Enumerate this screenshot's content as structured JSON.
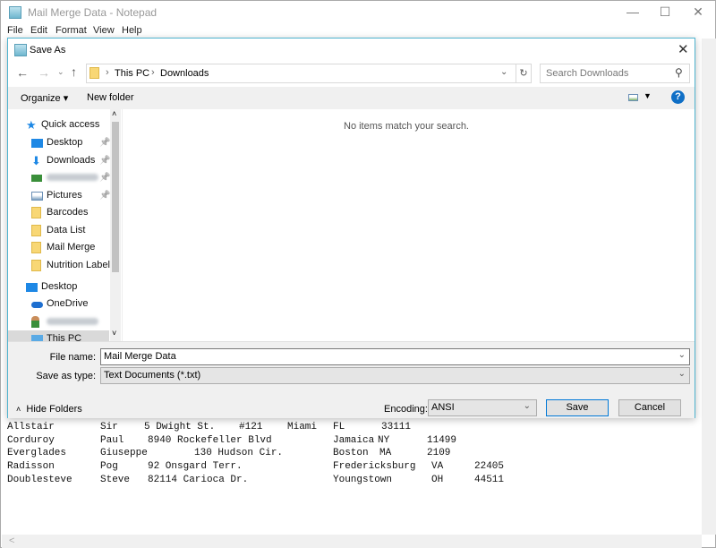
{
  "notepad": {
    "title": "Mail Merge Data - Notepad",
    "menu": [
      "File",
      "Edit",
      "Format",
      "View",
      "Help"
    ],
    "rows": [
      [
        "Allstair",
        "Sir",
        "5 Dwight St.",
        "#121",
        "Miami",
        "FL",
        "33111"
      ],
      [
        "Corduroy",
        "Paul",
        "8940 Rockefeller Blvd",
        "Jamaica",
        "NY",
        "11499"
      ],
      [
        "Everglades",
        "Giuseppe",
        "130 Hudson Cir.",
        "Boston",
        "MA",
        "2109"
      ],
      [
        "Radisson",
        "Pog",
        "92 Onsgard Terr.",
        "Fredericksburg",
        "VA",
        "22405"
      ],
      [
        "Doublesteve",
        "Steve",
        "82114 Carioca Dr.",
        "Youngstown",
        "OH",
        "44511"
      ]
    ],
    "scroll_left": "<"
  },
  "dialog": {
    "title": "Save As",
    "breadcrumb": [
      "This PC",
      "Downloads"
    ],
    "search_placeholder": "Search Downloads",
    "toolbar": {
      "organize": "Organize",
      "new_folder": "New folder"
    },
    "empty_message": "No items match your search.",
    "nav": {
      "quick_access": "Quick access",
      "quick_items": [
        "Desktop",
        "Downloads",
        "",
        "Pictures",
        "Barcodes",
        "Data List",
        "Mail Merge",
        "Nutrition Labels"
      ],
      "desktop": "Desktop",
      "onedrive": "OneDrive",
      "this_pc": "This PC"
    },
    "file_name_label": "File name:",
    "file_name": "Mail Merge Data",
    "save_type_label": "Save as type:",
    "save_type": "Text Documents (*.txt)",
    "hide_folders": "Hide Folders",
    "encoding_label": "Encoding:",
    "encoding": "ANSI",
    "save": "Save",
    "cancel": "Cancel"
  },
  "colors": {
    "accent": "#0078d7",
    "dialog_border": "#4fb3cf"
  }
}
